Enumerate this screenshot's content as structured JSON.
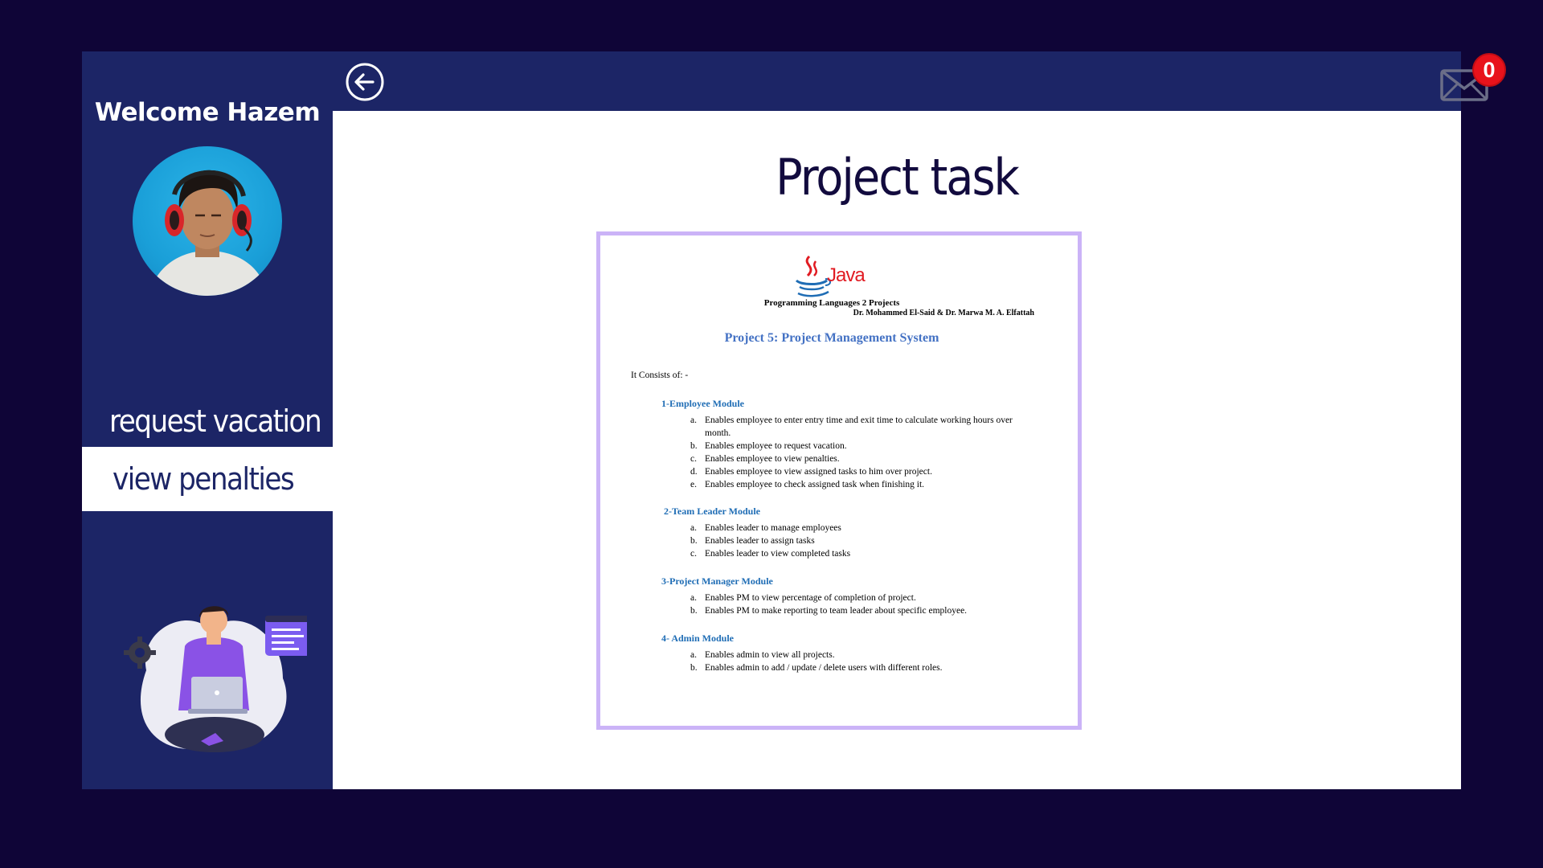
{
  "sidebar": {
    "welcome": "Welcome Hazem",
    "menu": [
      "request vacation",
      "view penalties"
    ]
  },
  "topbar": {
    "mail_count": "0"
  },
  "main": {
    "title": "Project task"
  },
  "document": {
    "logo_text": "Java",
    "course": "Programming Languages 2 Projects",
    "authors": "Dr. Mohammed El-Said & Dr. Marwa M. A. Elfattah",
    "heading": "Project 5: Project Management System",
    "intro": "It Consists of: -",
    "modules": [
      {
        "title": "1-Employee Module",
        "items": [
          {
            "letter": "a.",
            "text": "Enables employee to enter entry time and exit time to calculate working hours over month."
          },
          {
            "letter": "b.",
            "text": "Enables employee to request vacation."
          },
          {
            "letter": "c.",
            "text": "Enables employee to view penalties."
          },
          {
            "letter": "d.",
            "text": "Enables employee to view assigned tasks to him over project."
          },
          {
            "letter": "e.",
            "text": "Enables employee to check assigned task when finishing it."
          }
        ]
      },
      {
        "title": "2-Team Leader Module",
        "items": [
          {
            "letter": "a.",
            "text": "Enables leader to manage employees"
          },
          {
            "letter": "b.",
            "text": "Enables leader to assign tasks"
          },
          {
            "letter": "c.",
            "text": "Enables leader to view completed tasks"
          }
        ]
      },
      {
        "title": "3-Project Manager Module",
        "items": [
          {
            "letter": "a.",
            "text": "Enables PM to view percentage of completion of project."
          },
          {
            "letter": "b.",
            "text": "Enables PM to make reporting to team leader about specific employee."
          }
        ]
      },
      {
        "title": "4- Admin Module",
        "items": [
          {
            "letter": "a.",
            "text": "Enables admin to view all projects."
          },
          {
            "letter": "b.",
            "text": "Enables admin to add / update / delete users with different roles."
          }
        ]
      }
    ]
  },
  "colors": {
    "background": "#0f0537",
    "sidebar": "#1c2566",
    "accent_border": "#cbb3f7",
    "badge": "#e8121b",
    "doc_heading": "#4472c4",
    "module_heading": "#1f6db5"
  },
  "icons": {
    "back": "arrow-left-circle-icon",
    "mail": "envelope-icon"
  }
}
